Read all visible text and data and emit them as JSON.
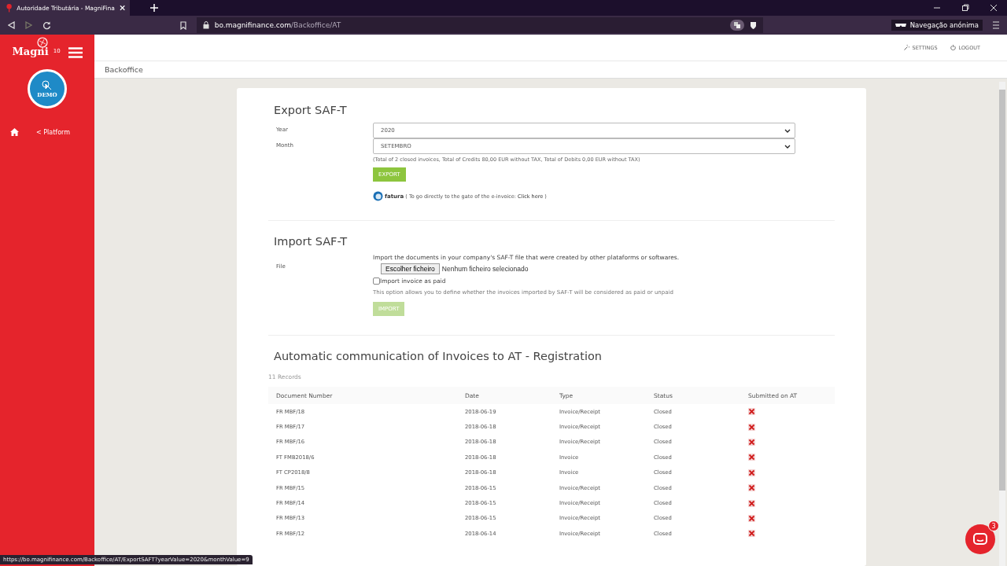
{
  "browser": {
    "tab_title": "Autoridade Tributária - MagniFina",
    "url_host": "bo.magnifinance.com",
    "url_path": "/Backoffice/AT",
    "incognito_label": "Navegação anónima",
    "status_url": "https://bo.magnifinance.com/Backoffice/AT/ExportSAFT?yearValue=2020&monthValue=9"
  },
  "sidebar": {
    "logo": "Magni",
    "logo_version": "10",
    "demo_badge": "DEMO",
    "platform_link": "< Platform"
  },
  "header": {
    "settings": "SETTINGS",
    "logout": "LOGOUT",
    "breadcrumb": "Backoffice"
  },
  "export": {
    "title": "Export SAF-T",
    "year_label": "Year",
    "year_value": "2020",
    "month_label": "Month",
    "month_value": "SETEMBRO",
    "totals": "(Total of 2 closed invoices, Total of Credits 80,00 EUR without TAX, Total of Debits 0,00 EUR without TAX)",
    "button": "EXPORT",
    "efatura": "fatura",
    "efatura_note": "( To go directly to the gate of the e-invoice:",
    "efatura_link": "Click here",
    "efatura_close": ")"
  },
  "import": {
    "title": "Import SAF-T",
    "file_label": "File",
    "description": "Import the documents in your company's SAF-T file that were created by other plataforms or softwares.",
    "choose_button": "Escolher ficheiro",
    "no_file": "Nenhum ficheiro selecionado",
    "paid_label": "Import invoice as paid",
    "paid_checked": false,
    "paid_hint": "This option allows you to define whether the invoices imported by SAF-T will be considered as paid or unpaid",
    "button": "IMPORT",
    "button_disabled": true
  },
  "registration": {
    "title": "Automatic communication of Invoices to AT - Registration",
    "records": "11 Records",
    "columns": [
      "Document Number",
      "Date",
      "Type",
      "Status",
      "Submitted on AT"
    ],
    "rows": [
      {
        "number": "FR MBF/18",
        "date": "2018-06-19",
        "type": "Invoice/Receipt",
        "status": "Closed",
        "submitted": false
      },
      {
        "number": "FR MBF/17",
        "date": "2018-06-18",
        "type": "Invoice/Receipt",
        "status": "Closed",
        "submitted": false
      },
      {
        "number": "FR MBF/16",
        "date": "2018-06-18",
        "type": "Invoice/Receipt",
        "status": "Closed",
        "submitted": false
      },
      {
        "number": "FT FMB2018/6",
        "date": "2018-06-18",
        "type": "Invoice",
        "status": "Closed",
        "submitted": false
      },
      {
        "number": "FT CP2018/8",
        "date": "2018-06-18",
        "type": "Invoice",
        "status": "Closed",
        "submitted": false
      },
      {
        "number": "FR MBF/15",
        "date": "2018-06-15",
        "type": "Invoice/Receipt",
        "status": "Closed",
        "submitted": false
      },
      {
        "number": "FR MBF/14",
        "date": "2018-06-15",
        "type": "Invoice/Receipt",
        "status": "Closed",
        "submitted": false
      },
      {
        "number": "FR MBF/13",
        "date": "2018-06-15",
        "type": "Invoice/Receipt",
        "status": "Closed",
        "submitted": false
      },
      {
        "number": "FR MBF/12",
        "date": "2018-06-14",
        "type": "Invoice/Receipt",
        "status": "Closed",
        "submitted": false
      }
    ]
  },
  "chat": {
    "badge": "3"
  }
}
